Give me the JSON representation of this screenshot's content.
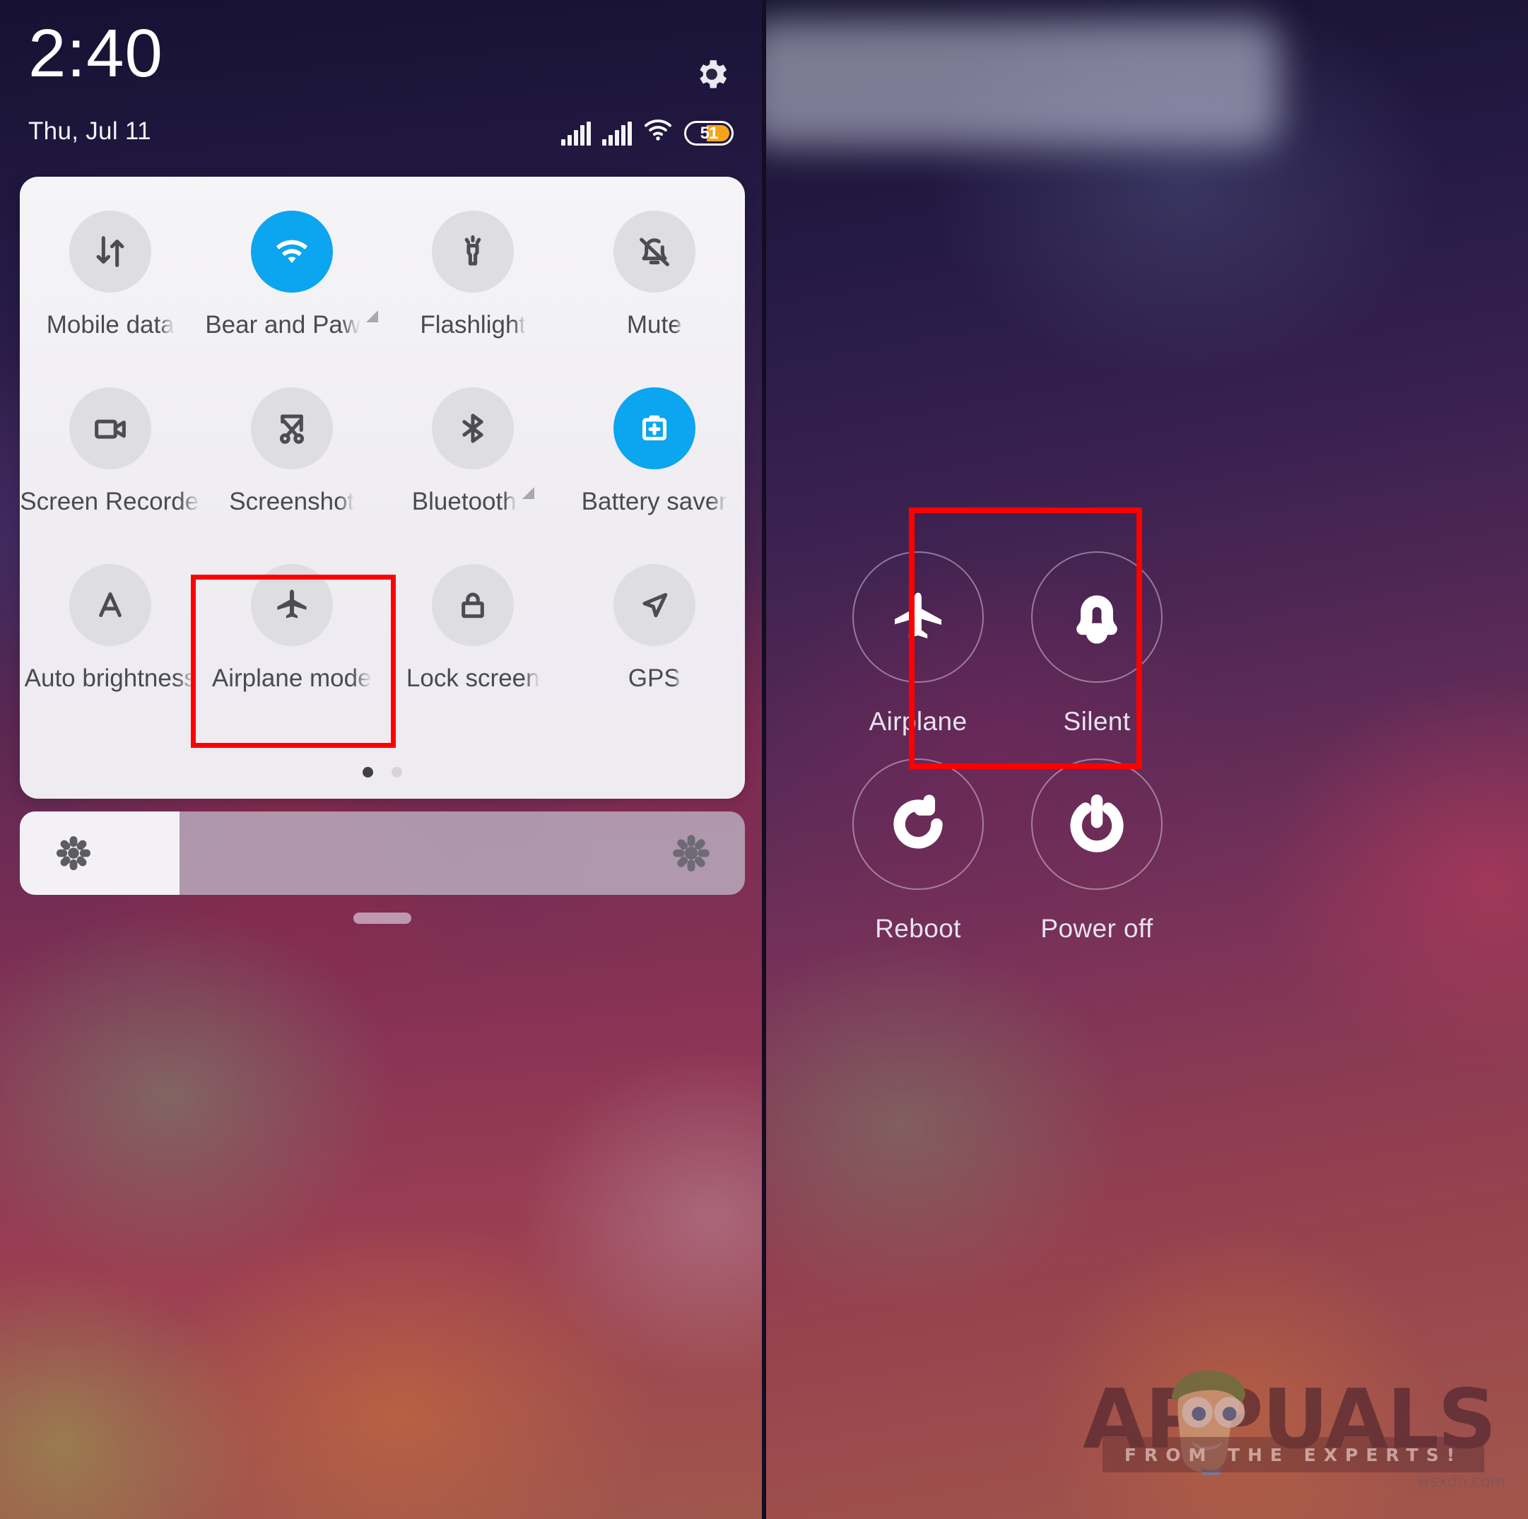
{
  "left_screen": {
    "status_bar": {
      "time": "2:40",
      "date": "Thu, Jul 11",
      "settings_icon": "gear-icon",
      "signal_icon_1": "signal-bars-icon",
      "signal_icon_2": "signal-bars-icon",
      "wifi_icon": "wifi-icon",
      "battery_percent": "51",
      "battery_icon": "battery-icon"
    },
    "quick_settings": {
      "tiles": [
        {
          "label": "Mobile data",
          "icon": "mobile-data-icon",
          "state": "off",
          "caret": false
        },
        {
          "label": "Bear and Paw",
          "icon": "wifi-icon",
          "state": "on",
          "caret": true
        },
        {
          "label": "Flashlight",
          "icon": "flashlight-icon",
          "state": "off",
          "caret": false
        },
        {
          "label": "Mute",
          "icon": "bell-muted-icon",
          "state": "off",
          "caret": false
        },
        {
          "label": "Screen Recorder",
          "icon": "video-camera-icon",
          "state": "off",
          "caret": false
        },
        {
          "label": "Screenshot",
          "icon": "scissors-icon",
          "state": "off",
          "caret": false
        },
        {
          "label": "Bluetooth",
          "icon": "bluetooth-icon",
          "state": "off",
          "caret": true
        },
        {
          "label": "Battery saver",
          "icon": "battery-plus-icon",
          "state": "on",
          "caret": false
        },
        {
          "label": "Auto brightness",
          "icon": "letter-a-icon",
          "state": "off",
          "caret": false
        },
        {
          "label": "Airplane mode",
          "icon": "airplane-icon",
          "state": "off",
          "caret": false
        },
        {
          "label": "Lock screen",
          "icon": "padlock-icon",
          "state": "off",
          "caret": false
        },
        {
          "label": "GPS",
          "icon": "location-arrow-icon",
          "state": "off",
          "caret": false
        }
      ],
      "page_dots": {
        "total": 2,
        "active_index": 0
      }
    },
    "brightness_slider": {
      "value_percent": 22,
      "low_icon": "sun-small-icon",
      "high_icon": "sun-large-icon"
    },
    "drag_handle": "shade-drag-handle",
    "highlight_box": {
      "target": "Airplane mode",
      "color": "#FF0000"
    }
  },
  "right_screen": {
    "power_menu": {
      "items": [
        {
          "label": "Airplane",
          "icon": "airplane-icon"
        },
        {
          "label": "Silent",
          "icon": "bell-icon"
        },
        {
          "label": "Reboot",
          "icon": "reboot-icon"
        },
        {
          "label": "Power off",
          "icon": "power-icon"
        }
      ]
    },
    "highlight_box": {
      "target": "Airplane",
      "color": "#FF0000"
    }
  },
  "watermark": {
    "word": "APPUALS",
    "tagline": "FROM THE EXPERTS!",
    "url": "wsxdn.com"
  },
  "colors": {
    "accent_on": "#0CA5F0",
    "tile_off": "#dedde1",
    "sheet_bg": "#f1eff4",
    "battery_fill": "#F7A31A",
    "highlight": "#FF0000"
  }
}
